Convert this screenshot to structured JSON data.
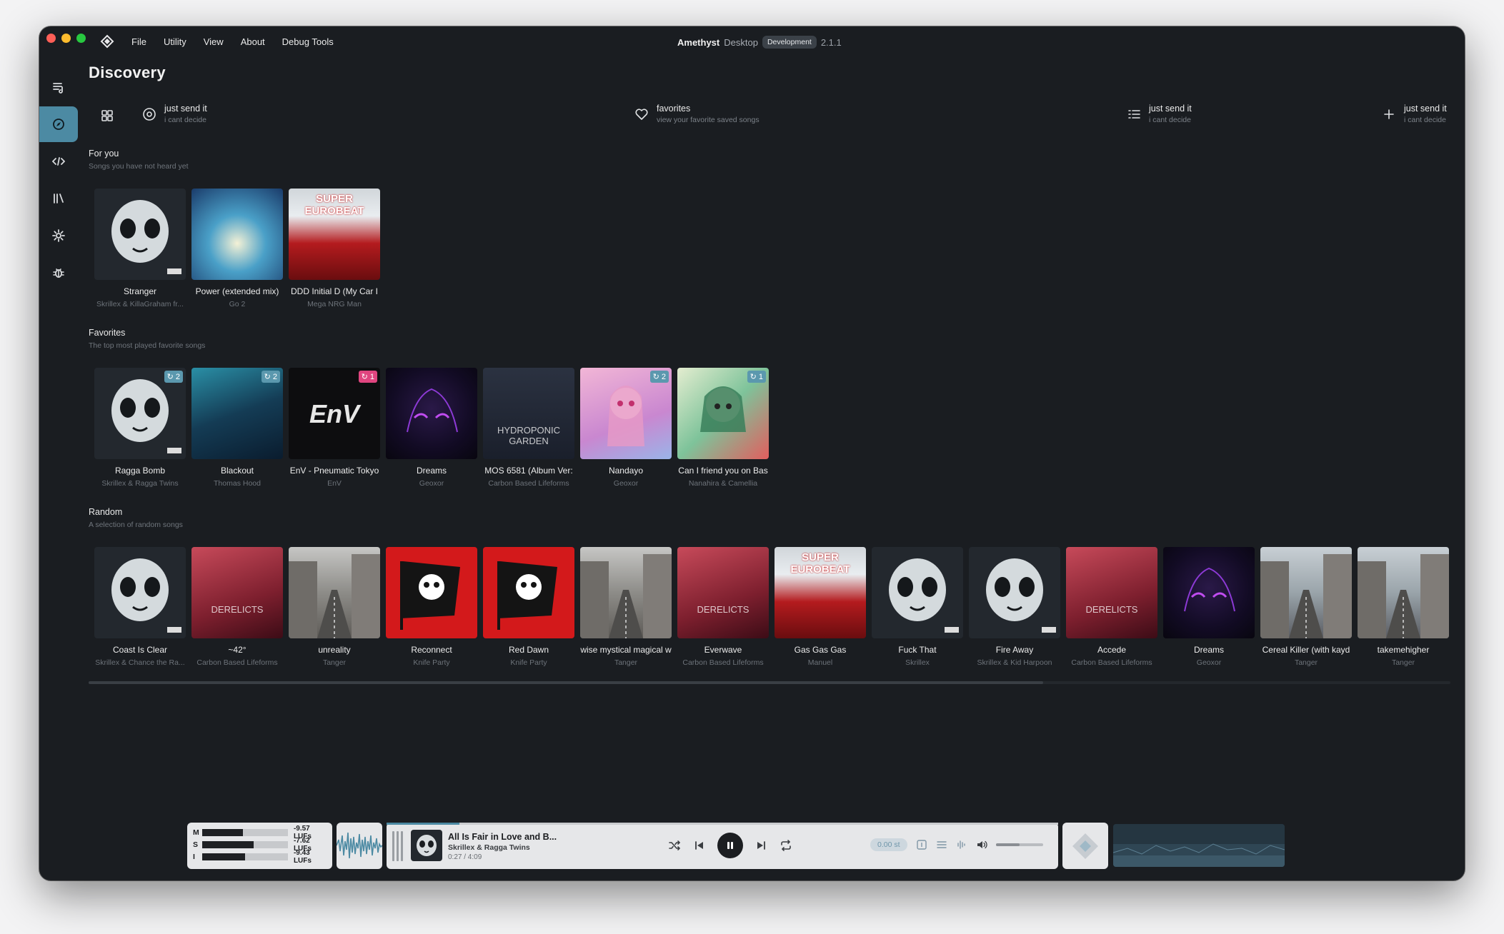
{
  "menu": {
    "items": [
      "File",
      "Utility",
      "View",
      "About",
      "Debug Tools"
    ]
  },
  "window_title": {
    "app": "Amethyst",
    "sub": "Desktop",
    "badge": "Development",
    "version": "2.1.1"
  },
  "page": {
    "title": "Discovery"
  },
  "quick_actions": [
    {
      "title": "just send it",
      "subtitle": "i cant decide",
      "icon": "radio-icon"
    },
    {
      "title": "favorites",
      "subtitle": "view your favorite saved songs",
      "icon": "heart-icon"
    },
    {
      "title": "just send it",
      "subtitle": "i cant decide",
      "icon": "list-icon"
    },
    {
      "title": "just send it",
      "subtitle": "i cant decide",
      "icon": "plus-icon"
    }
  ],
  "sections": {
    "for_you": {
      "title": "For you",
      "subtitle": "Songs you have not heard yet",
      "items": [
        {
          "title": "Stranger",
          "artist": "Skrillex & KillaGraham fr...",
          "art": "skull"
        },
        {
          "title": "Power (extended mix)",
          "artist": "Go 2",
          "art": "go2"
        },
        {
          "title": "DDD Initial D (My Car I",
          "artist": "Mega NRG Man",
          "art": "euro"
        }
      ]
    },
    "favorites": {
      "title": "Favorites",
      "subtitle": "The top most played favorite songs",
      "items": [
        {
          "title": "Ragga Bomb",
          "artist": "Skrillex & Ragga Twins",
          "art": "skull",
          "plays": "2",
          "badge": "blue"
        },
        {
          "title": "Blackout",
          "artist": "Thomas Hood",
          "art": "blackout",
          "plays": "2",
          "badge": "blue"
        },
        {
          "title": "EnV - Pneumatic Tokyo",
          "artist": "EnV",
          "art": "env",
          "plays": "1",
          "badge": "pink"
        },
        {
          "title": "Dreams",
          "artist": "Geoxor",
          "art": "dreams"
        },
        {
          "title": "MOS 6581 (Album Ver:",
          "artist": "Carbon Based Lifeforms",
          "art": "mos"
        },
        {
          "title": "Nandayo",
          "artist": "Geoxor",
          "art": "nandayo",
          "plays": "2",
          "badge": "blue"
        },
        {
          "title": "Can I friend you on Bas",
          "artist": "Nanahira & Camellia",
          "art": "canfriend",
          "plays": "1",
          "badge": "blue"
        }
      ]
    },
    "random": {
      "title": "Random",
      "subtitle": "A selection of random songs",
      "items": [
        {
          "title": "Coast Is Clear",
          "artist": "Skrillex & Chance the Ra...",
          "art": "skull"
        },
        {
          "title": "~42°",
          "artist": "Carbon Based Lifeforms",
          "art": "derelicts"
        },
        {
          "title": "unreality",
          "artist": "Tanger",
          "art": "tanger"
        },
        {
          "title": "Reconnect",
          "artist": "Knife Party",
          "art": "knife"
        },
        {
          "title": "Red Dawn",
          "artist": "Knife Party",
          "art": "knife"
        },
        {
          "title": "wise mystical magical w",
          "artist": "Tanger",
          "art": "tanger"
        },
        {
          "title": "Everwave",
          "artist": "Carbon Based Lifeforms",
          "art": "derelicts"
        },
        {
          "title": "Gas Gas Gas",
          "artist": "Manuel",
          "art": "euro"
        },
        {
          "title": "Fuck That",
          "artist": "Skrillex",
          "art": "skull"
        },
        {
          "title": "Fire Away",
          "artist": "Skrillex & Kid Harpoon",
          "art": "skull"
        },
        {
          "title": "Accede",
          "artist": "Carbon Based Lifeforms",
          "art": "derelicts"
        },
        {
          "title": "Dreams",
          "artist": "Geoxor",
          "art": "dreams"
        },
        {
          "title": "Cereal Killer (with kayd",
          "artist": "Tanger",
          "art": "street"
        },
        {
          "title": "takemehigher",
          "artist": "Tanger",
          "art": "street"
        }
      ]
    }
  },
  "art_labels": {
    "euro": "SUPER EUROBEAT",
    "derelicts": "DERELICTS",
    "mos": "HYDROPONIC GARDEN",
    "env": "EnV"
  },
  "loudness": {
    "rows": [
      {
        "key": "M",
        "value": "-9.57 LUFs",
        "level": 0.48
      },
      {
        "key": "S",
        "value": "-7.62 LUFs",
        "level": 0.6
      },
      {
        "key": "I",
        "value": "-9.43 LUFs",
        "level": 0.5
      }
    ]
  },
  "now_playing": {
    "title": "All Is Fair in Love and B...",
    "artist": "Skrillex & Ragga Twins",
    "time": "0:27 / 4:09",
    "progress": 0.108,
    "semitones": "0.00 st",
    "volume": 0.5
  },
  "colors": {
    "accent": "#4c8aa3",
    "badge_blue": "#5b98ae",
    "badge_pink": "#e0457f",
    "bg": "#1a1d21"
  }
}
